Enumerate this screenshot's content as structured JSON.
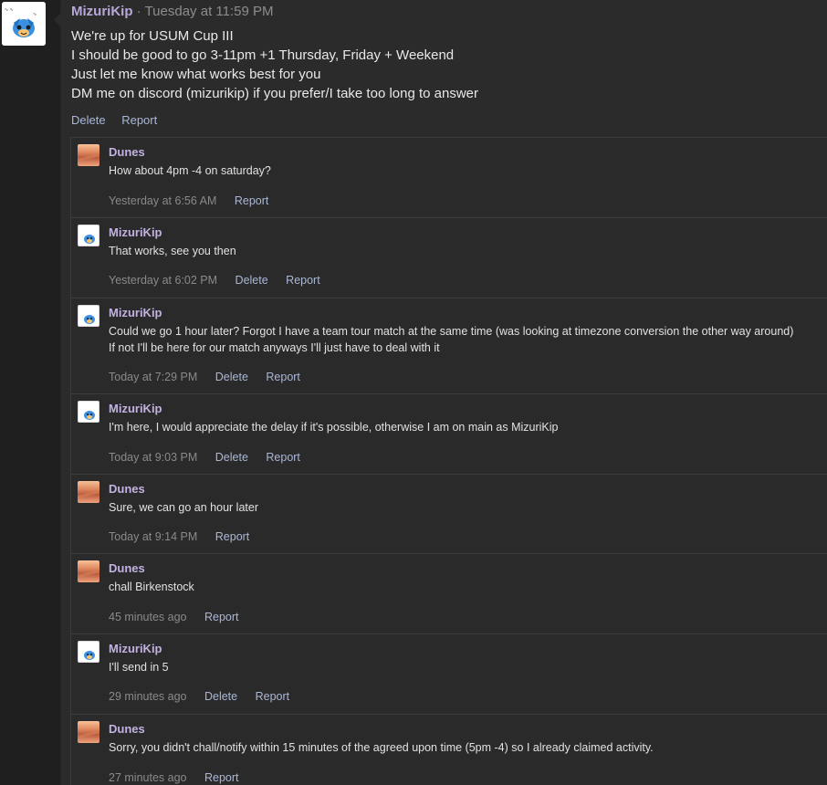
{
  "main_post": {
    "author": "MizuriKip",
    "separator": "·",
    "time": "Tuesday at 11:59 PM",
    "lines": [
      "We're up for USUM Cup III",
      "I should be good to go 3-11pm +1 Thursday, Friday + Weekend",
      "Just let me know what works best for you",
      "DM me on discord (mizurikip) if you prefer/I take too long to answer"
    ],
    "actions": {
      "delete": "Delete",
      "report": "Report"
    },
    "avatar_icon": "mudkip-avatar-icon"
  },
  "replies": [
    {
      "author": "Dunes",
      "text": [
        "How about 4pm -4 on saturday?"
      ],
      "time": "Yesterday at 6:56 AM",
      "actions": [
        "Report"
      ],
      "avatar_icon": "dunes-avatar-icon"
    },
    {
      "author": "MizuriKip",
      "text": [
        "That works, see you then"
      ],
      "time": "Yesterday at 6:02 PM",
      "actions": [
        "Delete",
        "Report"
      ],
      "avatar_icon": "mudkip-avatar-icon"
    },
    {
      "author": "MizuriKip",
      "text": [
        "Could we go 1 hour later? Forgot I have a team tour match at the same time (was looking at timezone conversion the other way around)",
        "If not I'll be here for our match anyways I'll just have to deal with it"
      ],
      "time": "Today at 7:29 PM",
      "actions": [
        "Delete",
        "Report"
      ],
      "avatar_icon": "mudkip-avatar-icon"
    },
    {
      "author": "MizuriKip",
      "text": [
        "I'm here, I would appreciate the delay if it's possible, otherwise I am on main as MizuriKip"
      ],
      "time": "Today at 9:03 PM",
      "actions": [
        "Delete",
        "Report"
      ],
      "avatar_icon": "mudkip-avatar-icon"
    },
    {
      "author": "Dunes",
      "text": [
        "Sure, we can go an hour later"
      ],
      "time": "Today at 9:14 PM",
      "actions": [
        "Report"
      ],
      "avatar_icon": "dunes-avatar-icon"
    },
    {
      "author": "Dunes",
      "text": [
        "chall Birkenstock"
      ],
      "time": "45 minutes ago",
      "actions": [
        "Report"
      ],
      "avatar_icon": "dunes-avatar-icon"
    },
    {
      "author": "MizuriKip",
      "text": [
        "I'll send in 5"
      ],
      "time": "29 minutes ago",
      "actions": [
        "Delete",
        "Report"
      ],
      "avatar_icon": "mudkip-avatar-icon"
    },
    {
      "author": "Dunes",
      "text": [
        "Sorry, you didn't chall/notify within 15 minutes of the agreed upon time (5pm -4) so I already claimed activity."
      ],
      "time": "27 minutes ago",
      "actions": [
        "Report"
      ],
      "avatar_icon": "dunes-avatar-icon"
    }
  ],
  "colors": {
    "author": "#b8a7d8",
    "link": "#a8b8d8",
    "background": "#2b2b2b",
    "sidebar": "#1f1f1f"
  }
}
